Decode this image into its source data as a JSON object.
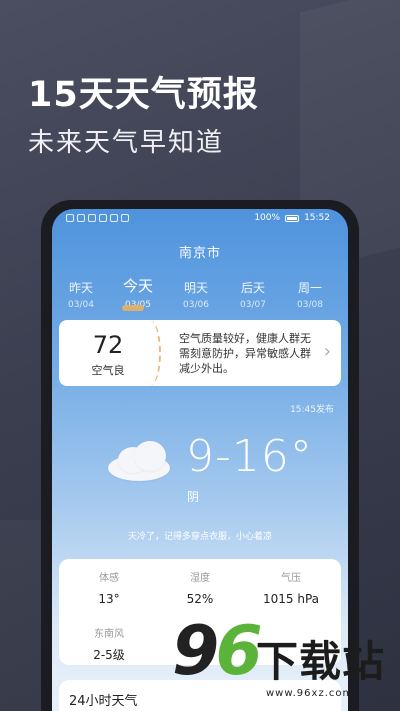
{
  "hero": {
    "title": "15天天气预报",
    "subtitle": "未来天气早知道"
  },
  "status_bar": {
    "battery": "100%",
    "time": "15:52"
  },
  "city": "南京市",
  "days": [
    {
      "name": "昨天",
      "date": "03/04"
    },
    {
      "name": "今天",
      "date": "03/05"
    },
    {
      "name": "明天",
      "date": "03/06"
    },
    {
      "name": "后天",
      "date": "03/07"
    },
    {
      "name": "周一",
      "date": "03/08"
    }
  ],
  "aqi": {
    "value": "72",
    "label": "空气良",
    "description": "空气质量较好，健康人群无需刻意防护，异常敏感人群减少外出。"
  },
  "publish_time": "15:45发布",
  "current": {
    "temp_range": "9-16°",
    "condition": "阴",
    "tip": "天冷了，记得多穿点衣服，小心着凉"
  },
  "stats": [
    {
      "label": "体感",
      "value": "13°"
    },
    {
      "label": "湿度",
      "value": "52%"
    },
    {
      "label": "气压",
      "value": "1015 hPa"
    },
    {
      "label": "东南风",
      "value": "2-5级"
    }
  ],
  "hourly": {
    "title": "24小时天气"
  },
  "watermark": {
    "digit_9": "9",
    "digit_6": "6",
    "text": "下载站",
    "url": "www.96xz.com"
  },
  "colors": {
    "background": "#3c3f50",
    "screen_top": "#4f93dd",
    "watermark_green": "#5bb33a"
  }
}
